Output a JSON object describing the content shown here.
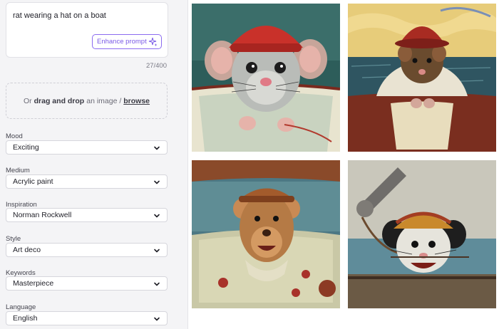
{
  "prompt": {
    "text": "rat wearing a hat on a boat",
    "enhance_label": "Enhance prompt",
    "char_count": "27/400"
  },
  "dropzone": {
    "prefix": "Or",
    "drag_text": "drag and drop",
    "middle": "an image /",
    "browse_label": "browse"
  },
  "fields": [
    {
      "label": "Mood",
      "value": "Exciting"
    },
    {
      "label": "Medium",
      "value": "Acrylic paint"
    },
    {
      "label": "Inspiration",
      "value": "Norman Rockwell"
    },
    {
      "label": "Style",
      "value": "Art deco"
    },
    {
      "label": "Keywords",
      "value": "Masterpiece"
    },
    {
      "label": "Language",
      "value": "English"
    }
  ],
  "images": [
    {
      "name": "generated-image-1",
      "alt": "grey rat in red beanie on boat"
    },
    {
      "name": "generated-image-2",
      "alt": "brown rat in red hat on boat at sea"
    },
    {
      "name": "generated-image-3",
      "alt": "brown rat in cap smiling on boat"
    },
    {
      "name": "generated-image-4",
      "alt": "white rat in striped hat near crane"
    }
  ],
  "colors": {
    "accent": "#7a5ae6",
    "panel_bg": "#f4f4f6"
  }
}
